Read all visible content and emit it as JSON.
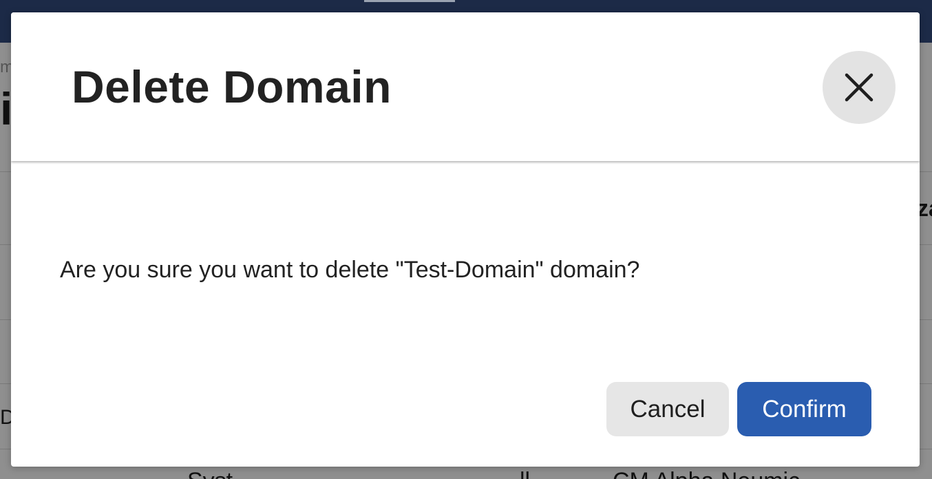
{
  "background": {
    "fragments": {
      "breadcrumb_fragment": "ma",
      "title_fragment": "i",
      "column_fragment": "za",
      "row_fragment": "DE",
      "bottom_row_fragment_1": "Syst",
      "bottom_row_fragment_2": "ll",
      "bottom_row_fragment_3": "CM Alpha Neumic"
    }
  },
  "dialog": {
    "title": "Delete Domain",
    "close_icon": "close-icon",
    "message": "Are you sure you want to delete \"Test-Domain\" domain?",
    "cancel_label": "Cancel",
    "confirm_label": "Confirm"
  },
  "colors": {
    "primary": "#2a5db0",
    "topbar": "#1c2a47",
    "overlay": "#8e8e8e",
    "secondary_button": "#e6e6e6"
  }
}
